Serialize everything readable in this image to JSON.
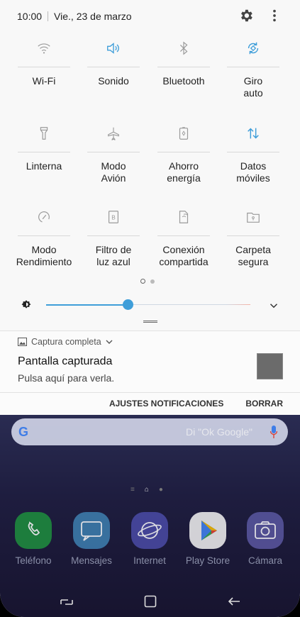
{
  "status": {
    "time": "10:00",
    "date": "Vie., 23 de marzo"
  },
  "icons": {
    "settings": "gear-icon",
    "more": "more-vert-icon"
  },
  "tiles": [
    {
      "label": "Wi-Fi",
      "icon": "wifi-icon",
      "active": false
    },
    {
      "label": "Sonido",
      "icon": "sound-icon",
      "active": true
    },
    {
      "label": "Bluetooth",
      "icon": "bluetooth-icon",
      "active": false
    },
    {
      "label": "Giro\nauto",
      "icon": "rotate-icon",
      "active": true
    },
    {
      "label": "Linterna",
      "icon": "flashlight-icon",
      "active": false
    },
    {
      "label": "Modo\nAvión",
      "icon": "airplane-icon",
      "active": false
    },
    {
      "label": "Ahorro\nenergía",
      "icon": "battery-icon",
      "active": false
    },
    {
      "label": "Datos\nmóviles",
      "icon": "mobile-data-icon",
      "active": true
    },
    {
      "label": "Modo\nRendimiento",
      "icon": "gauge-icon",
      "active": false
    },
    {
      "label": "Filtro de\nluz azul",
      "icon": "blue-light-icon",
      "active": false
    },
    {
      "label": "Conexión\ncompartida",
      "icon": "hotspot-icon",
      "active": false
    },
    {
      "label": "Carpeta\nsegura",
      "icon": "secure-folder-icon",
      "active": false
    }
  ],
  "brightness": {
    "level": 0.4
  },
  "notification": {
    "app_name": "Captura completa",
    "title": "Pantalla capturada",
    "body": "Pulsa aquí para verla.",
    "actions": [
      "AJUSTES NOTIFICACIONES",
      "BORRAR"
    ]
  },
  "home": {
    "search_placeholder": "Di \"Ok Google\"",
    "dock": [
      {
        "label": "Teléfono",
        "icon": "phone-icon",
        "color": "#1e8f3e"
      },
      {
        "label": "Mensajes",
        "icon": "messages-icon",
        "color": "#3e7fb0"
      },
      {
        "label": "Internet",
        "icon": "internet-icon",
        "color": "#4a4ba6"
      },
      {
        "label": "Play Store",
        "icon": "play-store-icon",
        "color": "#f2f2f2"
      },
      {
        "label": "Cámara",
        "icon": "camera-icon",
        "color": "#5a57a0"
      }
    ]
  },
  "colors": {
    "accent": "#3f9ed9",
    "inactive_icon": "#9a9a9a"
  }
}
